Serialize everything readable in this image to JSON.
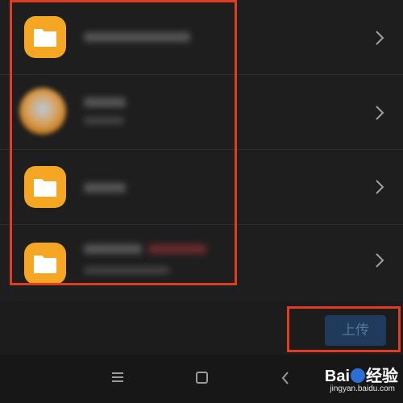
{
  "folders": [
    {
      "icon": "folder-icon",
      "name": "",
      "subtitle": ""
    },
    {
      "icon": "avatar",
      "name": "",
      "subtitle": ""
    },
    {
      "icon": "folder-icon",
      "name": "",
      "subtitle": ""
    },
    {
      "icon": "folder-icon",
      "name": "",
      "subtitle": ""
    }
  ],
  "upload_button": {
    "label": "上传",
    "state": "disabled",
    "color": "#203a5c"
  },
  "highlight_color": "#e23b1f",
  "accent_folder_color": "#f5a623",
  "navbar": {
    "icons": [
      "menu-icon",
      "home-icon",
      "back-icon"
    ]
  },
  "watermark": {
    "brand": "Bai",
    "brand_suffix": "经验",
    "url": "jingyan.baidu.com"
  }
}
